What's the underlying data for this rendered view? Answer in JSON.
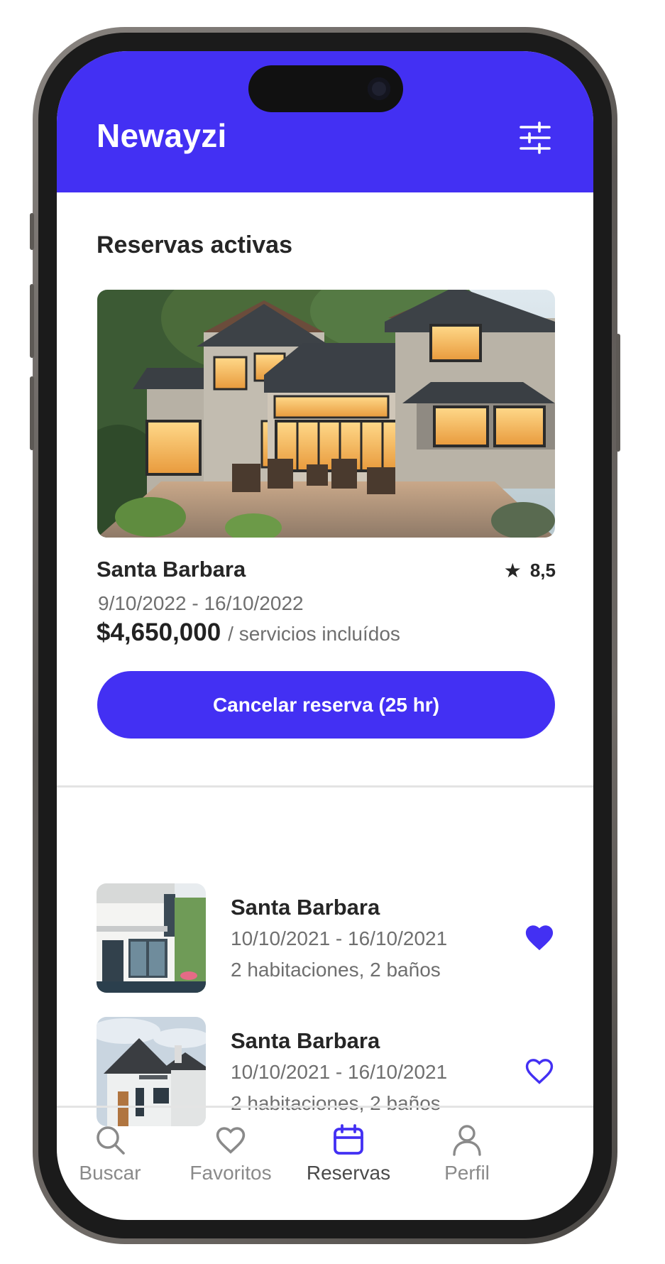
{
  "header": {
    "app_title": "Newayzi",
    "filter_icon": "sliders-icon"
  },
  "colors": {
    "brand": "#4330f3",
    "text_primary": "#262626",
    "text_secondary": "#6f6f6f",
    "nav_inactive": "#8a8a8a"
  },
  "active_section": {
    "title": "Reservas activas",
    "listing": {
      "name": "Santa Barbara",
      "rating": "8,5",
      "dates": "9/10/2022 - 16/10/2022",
      "price": "$4,650,000",
      "price_note": "/ servicios incluídos",
      "cancel_label": "Cancelar reserva (25 hr)"
    }
  },
  "list": [
    {
      "name": "Santa Barbara",
      "dates": "10/10/2021 - 16/10/2021",
      "rooms": "2 habitaciones, 2 baños",
      "favorite": true
    },
    {
      "name": "Santa Barbara",
      "dates": "10/10/2021 - 16/10/2021",
      "rooms": "2 habitaciones, 2 baños",
      "favorite": false
    }
  ],
  "nav": {
    "items": [
      {
        "label": "Buscar",
        "icon": "search-icon"
      },
      {
        "label": "Favoritos",
        "icon": "heart-icon"
      },
      {
        "label": "Reservas",
        "icon": "calendar-icon",
        "active": true
      },
      {
        "label": "Perfil",
        "icon": "user-icon"
      }
    ]
  }
}
